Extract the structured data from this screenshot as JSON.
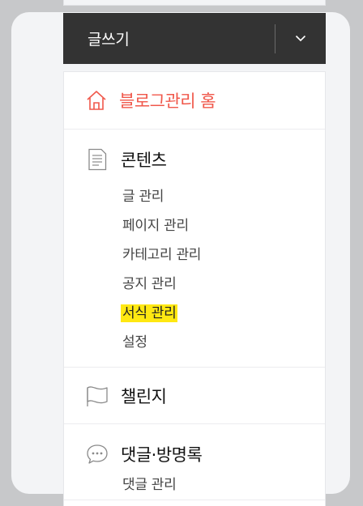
{
  "write": {
    "label": "글쓰기"
  },
  "menu": {
    "home": {
      "label": "블로그관리 홈"
    },
    "content": {
      "title": "콘텐츠",
      "items": [
        "글 관리",
        "페이지 관리",
        "카테고리 관리",
        "공지 관리",
        "서식 관리",
        "설정"
      ],
      "active_item": "서식 관리"
    },
    "challenge": {
      "title": "챌린지"
    },
    "comments": {
      "title": "댓글·방명록",
      "items": [
        "댓글 관리"
      ]
    }
  },
  "colors": {
    "home_accent": "#f0584b",
    "write_bar": "#333333",
    "active_highlight": "#ffe812"
  }
}
